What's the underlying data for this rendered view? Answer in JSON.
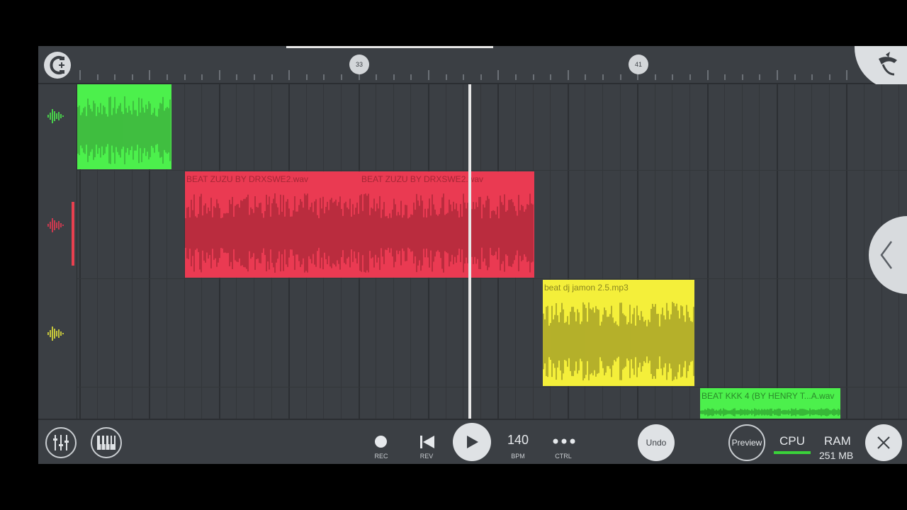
{
  "ruler": {
    "markers": [
      "33",
      "41"
    ]
  },
  "clips": [
    {
      "label": "",
      "color": "#4cf04c",
      "wave": "#3aa83a"
    },
    {
      "label": "BEAT ZUZU BY DRXSWE2.wav",
      "label2": "BEAT ZUZU BY DRXSWE2.wav",
      "color": "#ea3a52",
      "wave": "#a52636"
    },
    {
      "label": "beat dj jamon 2.5.mp3",
      "color": "#f4ef3a",
      "wave": "#9a9624"
    },
    {
      "label": "BEAT KKK 4 (BY HENRY T...A.wav",
      "color": "#4cf04c",
      "wave": "#2fa02f"
    }
  ],
  "tracks": [
    {
      "icon": "waveform-icon",
      "color": "#4cf04c"
    },
    {
      "icon": "waveform-icon",
      "color": "#ea3a52"
    },
    {
      "icon": "waveform-icon",
      "color": "#e6e53a"
    }
  ],
  "transport": {
    "rec_label": "REC",
    "rev_label": "REV",
    "bpm_value": "140",
    "bpm_label": "BPM",
    "ctrl_label": "CTRL",
    "undo_label": "Undo",
    "preview_label": "Preview",
    "cpu_label": "CPU",
    "ram_label": "RAM",
    "ram_value": "251 MB"
  },
  "colors": {
    "accent": "#3ad23a",
    "panel": "#3b3f44"
  }
}
